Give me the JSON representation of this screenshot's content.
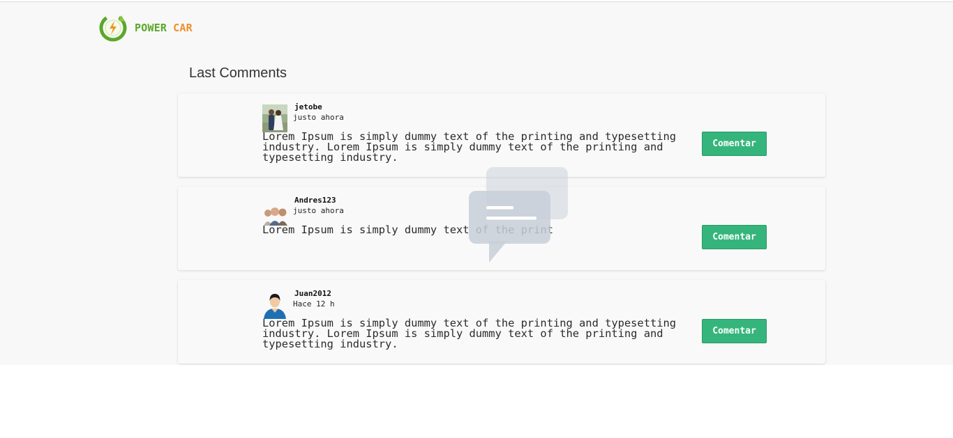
{
  "brand": {
    "word1": "POWER",
    "word2": "CAR"
  },
  "page_title": "Last Comments",
  "comments": [
    {
      "username": "jetobe",
      "time": "justo ahora",
      "text": "Lorem Ipsum is simply dummy text of the printing and typesetting industry. Lorem Ipsum is simply dummy text of the printing and typesetting industry.",
      "button": "Comentar"
    },
    {
      "username": "Andres123",
      "time": "justo ahora",
      "text": "Lorem Ipsum is simply dummy text of the print",
      "button": "Comentar"
    },
    {
      "username": "Juan2012",
      "time": "Hace 12 h",
      "text": "Lorem Ipsum is simply dummy text of the printing and typesetting industry. Lorem Ipsum is simply dummy text of the printing and typesetting industry.",
      "button": "Comentar"
    }
  ],
  "icons": {
    "logo": "power-leaf-bolt-icon",
    "watermark": "chat-bubbles-icon"
  },
  "colors": {
    "brand_green": "#5aa829",
    "brand_orange": "#f0902c",
    "button": "#35b57b"
  }
}
